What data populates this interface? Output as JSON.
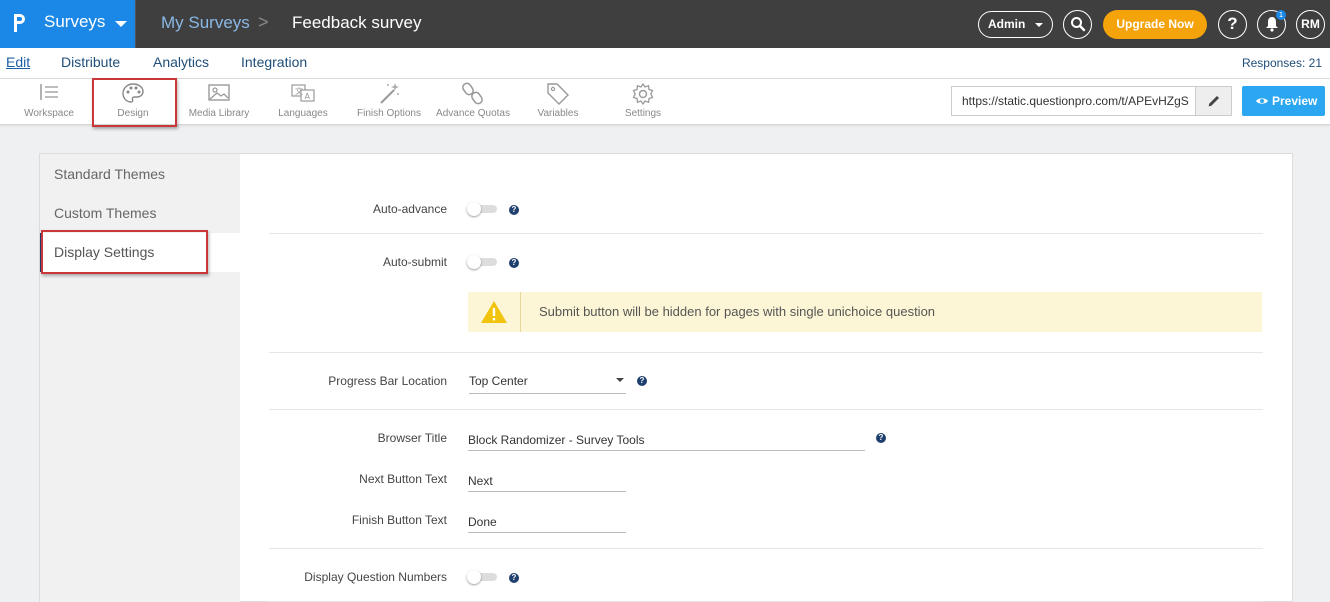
{
  "topbar": {
    "brand": "Surveys",
    "breadcrumb_root": "My Surveys",
    "breadcrumb_sep": ">",
    "breadcrumb_current": "Feedback survey",
    "admin_label": "Admin",
    "upgrade_label": "Upgrade Now",
    "help_label": "?",
    "notification_count": "1",
    "avatar_initials": "RM"
  },
  "nav": {
    "tabs": [
      {
        "label": "Edit"
      },
      {
        "label": "Distribute"
      },
      {
        "label": "Analytics"
      },
      {
        "label": "Integration"
      }
    ],
    "responses": "Responses: 21"
  },
  "toolbar": {
    "items": [
      {
        "label": "Workspace",
        "icon": "workspace-icon"
      },
      {
        "label": "Design",
        "icon": "palette-icon"
      },
      {
        "label": "Media Library",
        "icon": "image-icon"
      },
      {
        "label": "Languages",
        "icon": "translate-icon"
      },
      {
        "label": "Finish Options",
        "icon": "wand-icon"
      },
      {
        "label": "Advance Quotas",
        "icon": "link-icon"
      },
      {
        "label": "Variables",
        "icon": "tag-icon"
      },
      {
        "label": "Settings",
        "icon": "gear-icon"
      }
    ],
    "url": "https://static.questionpro.com/t/APEvHZgS",
    "preview_label": "Preview"
  },
  "sidemenu": {
    "items": [
      {
        "label": "Standard Themes"
      },
      {
        "label": "Custom Themes"
      },
      {
        "label": "Display Settings"
      }
    ]
  },
  "settings": {
    "auto_advance": {
      "label": "Auto-advance",
      "enabled": false
    },
    "auto_submit": {
      "label": "Auto-submit",
      "enabled": false
    },
    "warning": "Submit button will be hidden for pages with single unichoice question",
    "progress_bar": {
      "label": "Progress Bar Location",
      "value": "Top Center"
    },
    "browser_title": {
      "label": "Browser Title",
      "value": "Block Randomizer - Survey Tools"
    },
    "next_button": {
      "label": "Next Button Text",
      "value": "Next"
    },
    "finish_button": {
      "label": "Finish Button Text",
      "value": "Done"
    },
    "display_question_numbers": {
      "label": "Display Question Numbers",
      "enabled": false
    }
  },
  "colors": {
    "brand_blue": "#1b87e6",
    "topbar_bg": "#3f3f3f",
    "upgrade_orange": "#f4a30a",
    "preview_blue": "#2ba6f0",
    "highlight_red": "#c9373a",
    "warning_bg": "#fdf6d6"
  }
}
